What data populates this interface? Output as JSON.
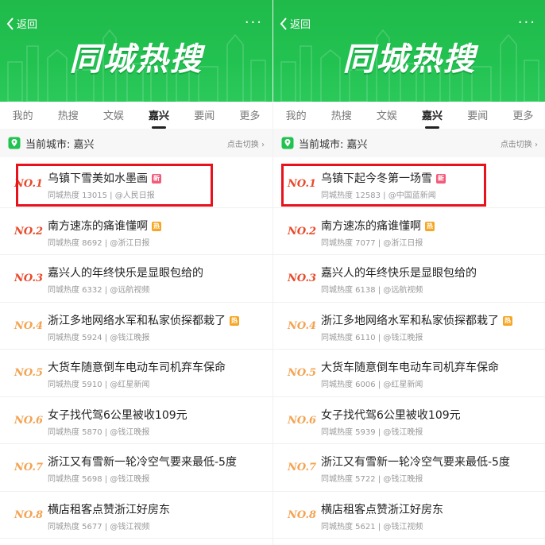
{
  "colors": {
    "banner_green": "#22c251",
    "rank_red": "#e84a2b",
    "rank_orange": "#f3a352",
    "badge_new": "#f25c7a",
    "badge_hot": "#f6a623",
    "highlight": "#e8121d"
  },
  "panels": [
    {
      "back_label": "返回",
      "more_icon": "ellipsis-icon",
      "banner_title": "同城热搜",
      "tabs": [
        "我的",
        "热搜",
        "文娱",
        "嘉兴",
        "要闻",
        "更多"
      ],
      "active_tab": "嘉兴",
      "city_label": "当前城市: 嘉兴",
      "switch_label": "点击切换 ›",
      "items": [
        {
          "rank": "NO.1",
          "title": "乌镇下雪美如水墨画",
          "badge": "新",
          "badge_type": "new",
          "meta": "同城热度 13015 | @人民日报"
        },
        {
          "rank": "NO.2",
          "title": "南方速冻的痛谁懂啊",
          "badge": "热",
          "badge_type": "hot",
          "meta": "同城热度 8692 | @浙江日报"
        },
        {
          "rank": "NO.3",
          "title": "嘉兴人的年终快乐是显眼包给的",
          "badge": "",
          "badge_type": "",
          "meta": "同城热度 6332 | @远航视频"
        },
        {
          "rank": "NO.4",
          "title": "浙江多地网络水军和私家侦探都栽了",
          "badge": "热",
          "badge_type": "hot",
          "meta": "同城热度 5924 | @钱江晚报"
        },
        {
          "rank": "NO.5",
          "title": "大货车随意倒车电动车司机弃车保命",
          "badge": "",
          "badge_type": "",
          "meta": "同城热度 5910 | @红星新闻"
        },
        {
          "rank": "NO.6",
          "title": "女子找代驾6公里被收109元",
          "badge": "",
          "badge_type": "",
          "meta": "同城热度 5870 | @钱江晚报"
        },
        {
          "rank": "NO.7",
          "title": "浙江又有雪新一轮冷空气要来最低-5度",
          "badge": "",
          "badge_type": "",
          "meta": "同城热度 5698 | @钱江晚报"
        },
        {
          "rank": "NO.8",
          "title": "横店租客点赞浙江好房东",
          "badge": "",
          "badge_type": "",
          "meta": "同城热度 5677 | @钱江视频"
        }
      ]
    },
    {
      "back_label": "返回",
      "more_icon": "ellipsis-icon",
      "banner_title": "同城热搜",
      "tabs": [
        "我的",
        "热搜",
        "文娱",
        "嘉兴",
        "要闻",
        "更多"
      ],
      "active_tab": "嘉兴",
      "city_label": "当前城市: 嘉兴",
      "switch_label": "点击切换 ›",
      "items": [
        {
          "rank": "NO.1",
          "title": "乌镇下起今冬第一场雪",
          "badge": "新",
          "badge_type": "new",
          "meta": "同城热度 12583 | @中国蓝新闻"
        },
        {
          "rank": "NO.2",
          "title": "南方速冻的痛谁懂啊",
          "badge": "热",
          "badge_type": "hot",
          "meta": "同城热度 7077 | @浙江日报"
        },
        {
          "rank": "NO.3",
          "title": "嘉兴人的年终快乐是显眼包给的",
          "badge": "",
          "badge_type": "",
          "meta": "同城热度 6138 | @远航视频"
        },
        {
          "rank": "NO.4",
          "title": "浙江多地网络水军和私家侦探都栽了",
          "badge": "热",
          "badge_type": "hot",
          "meta": "同城热度 6110 | @钱江晚报"
        },
        {
          "rank": "NO.5",
          "title": "大货车随意倒车电动车司机弃车保命",
          "badge": "",
          "badge_type": "",
          "meta": "同城热度 6006 | @红星新闻"
        },
        {
          "rank": "NO.6",
          "title": "女子找代驾6公里被收109元",
          "badge": "",
          "badge_type": "",
          "meta": "同城热度 5939 | @钱江晚报"
        },
        {
          "rank": "NO.7",
          "title": "浙江又有雪新一轮冷空气要来最低-5度",
          "badge": "",
          "badge_type": "",
          "meta": "同城热度 5722 | @钱江晚报"
        },
        {
          "rank": "NO.8",
          "title": "横店租客点赞浙江好房东",
          "badge": "",
          "badge_type": "",
          "meta": "同城热度 5621 | @钱江视频"
        }
      ]
    }
  ]
}
